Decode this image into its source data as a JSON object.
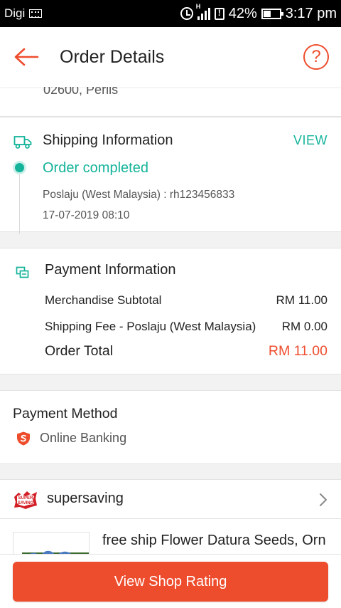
{
  "status_bar": {
    "carrier": "Digi",
    "network_type": "H",
    "battery": "42%",
    "time": "3:17 pm"
  },
  "header": {
    "title": "Order Details",
    "help_label": "?"
  },
  "address": {
    "last_line": "02600, Perlis"
  },
  "shipping": {
    "title": "Shipping Information",
    "view_label": "VIEW",
    "status": "Order completed",
    "courier": "Poslaju (West Malaysia) :  rh123456833",
    "date": "17-07-2019 08:10"
  },
  "payment_info": {
    "title": "Payment Information",
    "rows": [
      {
        "label": "Merchandise Subtotal",
        "value": "RM 11.00"
      },
      {
        "label": "Shipping Fee - Poslaju (West Malaysia)",
        "value": "RM 0.00"
      }
    ],
    "total_label": "Order Total",
    "total_value": "RM 11.00"
  },
  "payment_method": {
    "title": "Payment Method",
    "value": "Online Banking"
  },
  "shop": {
    "name": "supersaving",
    "logo_text": "SUPERSAVING"
  },
  "product": {
    "name": "free ship Flower Datura Seeds, Orn"
  },
  "bottom": {
    "cta_label": "View Shop Rating"
  },
  "colors": {
    "accent": "#ee4d2d",
    "teal": "#14b39a",
    "text": "#222222",
    "muted": "#555555",
    "background": "#f2f2f2"
  },
  "icons": {
    "back": "arrow-left-icon",
    "help": "question-circle-icon",
    "shipping": "truck-icon",
    "payment": "payment-icon",
    "method": "shield-s-icon",
    "chevron": "chevron-right-icon"
  }
}
